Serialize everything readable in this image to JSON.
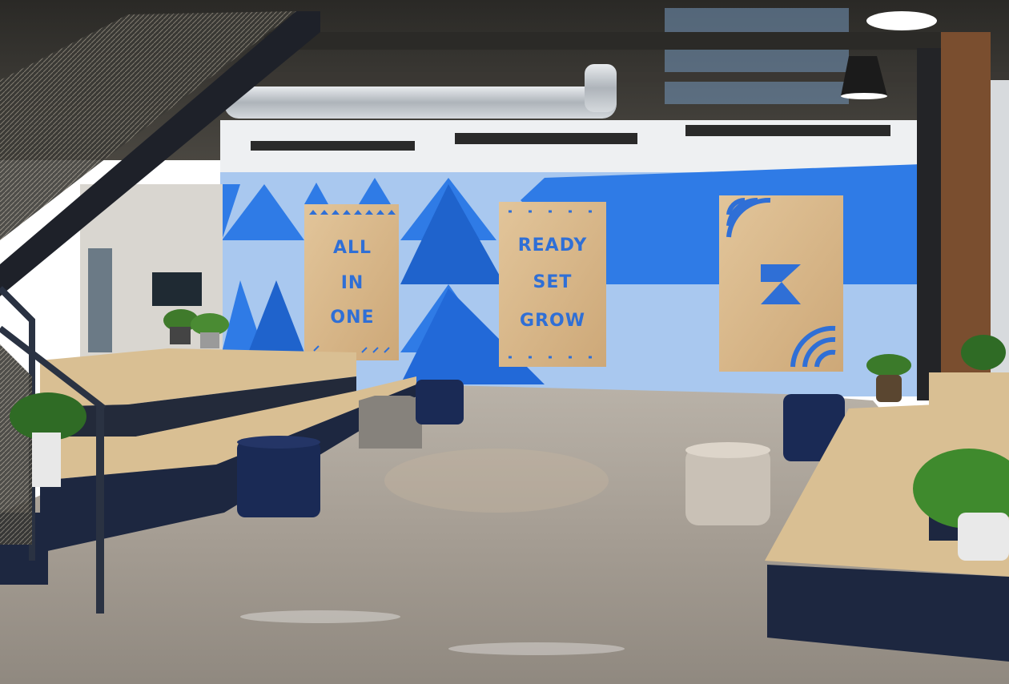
{
  "scene": {
    "description_free": true,
    "colors": {
      "wall_blue": "#2f7be6",
      "wall_light_blue": "#a9c8ef",
      "plywood": "#d8b78a",
      "floor": "#a9a39b",
      "navy": "#1d2a44",
      "stone": "#b7b0a6",
      "wood_top": "#d9bf93"
    }
  },
  "signs": {
    "left": {
      "line1": "ALL",
      "line2": "IN",
      "line3": "ONE"
    },
    "center": {
      "line1": "READY",
      "line2": "SET",
      "line3": "GROW"
    },
    "right": {
      "icon": "wifi-k-logo-icon"
    }
  }
}
